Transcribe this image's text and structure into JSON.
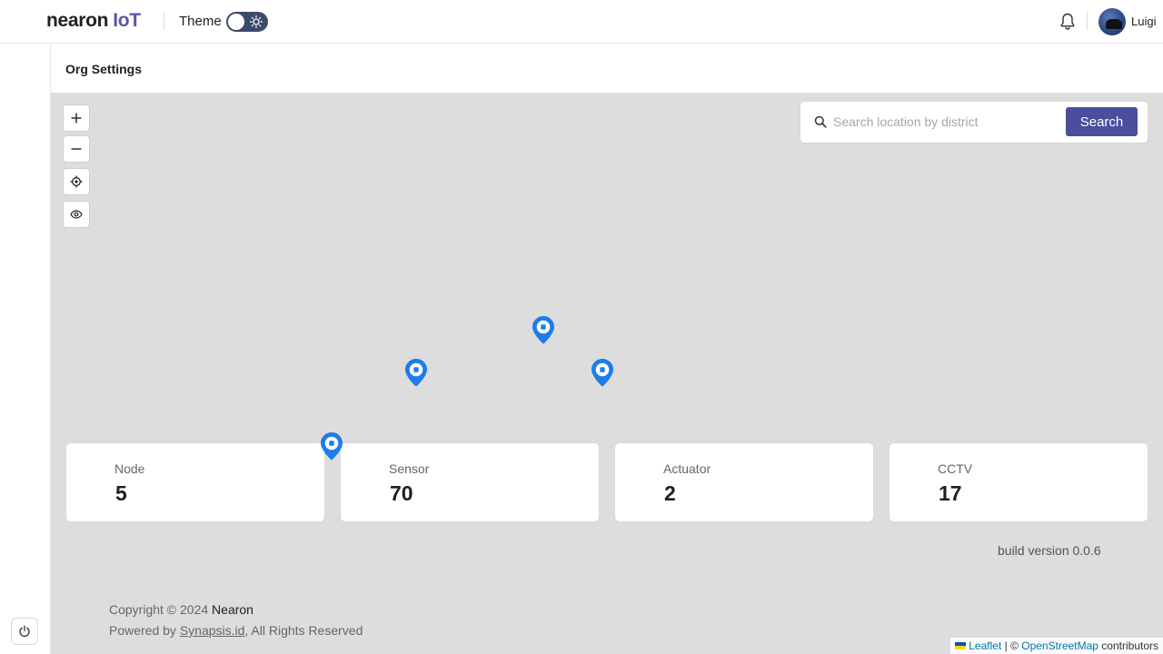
{
  "app": {
    "logo_brand": "nearon",
    "logo_suffix": "IoT",
    "theme_label": "Theme",
    "user_name": "Luigi"
  },
  "page": {
    "title": "Org Settings"
  },
  "search": {
    "placeholder": "Search location by district",
    "value": "",
    "button_label": "Search"
  },
  "stats": [
    {
      "label": "Node",
      "value": "5"
    },
    {
      "label": "Sensor",
      "value": "70"
    },
    {
      "label": "Actuator",
      "value": "2"
    },
    {
      "label": "CCTV",
      "value": "17"
    }
  ],
  "footer": {
    "build_version": "build version 0.0.6",
    "copyright_prefix": "Copyright © 2024 ",
    "copyright_company": "Nearon",
    "powered_prefix": "Powered by ",
    "powered_link": "Synapsis.id",
    "powered_suffix": ", All Rights Reserved"
  },
  "map_attribution": {
    "leaflet": "Leaflet",
    "separator": " | © ",
    "osm": "OpenStreetMap",
    "suffix": " contributors"
  },
  "colors": {
    "brand_accent": "#5a56a8",
    "search_button": "#4b4e9c",
    "toggle_track": "#3e4a6b",
    "marker": "#1e7de6",
    "map_background": "#dddddd"
  },
  "icons": {
    "theme_toggle": "sun-icon",
    "notifications": "bell-icon",
    "zoom_in": "plus-icon",
    "zoom_out": "minus-icon",
    "locate": "crosshair-icon",
    "layers": "eye-icon",
    "search": "search-icon",
    "logout": "power-icon",
    "map_marker": "map-pin-icon"
  }
}
